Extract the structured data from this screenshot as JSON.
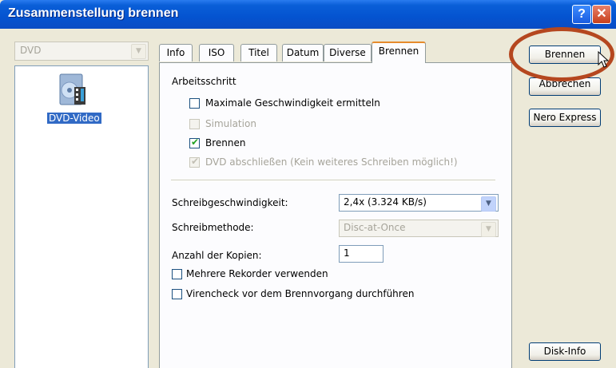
{
  "window": {
    "title": "Zusammenstellung brennen",
    "help_glyph": "?",
    "close_glyph": "✕"
  },
  "left": {
    "disc_type_select": "DVD",
    "items": [
      {
        "label": "DVD-Video",
        "icon": "dvd-video-icon"
      }
    ]
  },
  "tabs": [
    {
      "label": "Info",
      "active": false
    },
    {
      "label": "ISO",
      "active": false
    },
    {
      "label": "Titel",
      "active": false
    },
    {
      "label": "Datum",
      "active": false
    },
    {
      "label": "Diverse",
      "active": false
    },
    {
      "label": "Brennen",
      "active": true
    }
  ],
  "burn": {
    "section_title": "Arbeitsschritt",
    "max_speed": {
      "label": "Maximale Geschwindigkeit ermitteln",
      "checked": false,
      "enabled": true
    },
    "simulation": {
      "label": "Simulation",
      "checked": false,
      "enabled": false
    },
    "burn": {
      "label": "Brennen",
      "checked": true,
      "enabled": true
    },
    "finalize": {
      "label": "DVD abschließen (Kein weiteres Schreiben möglich!)",
      "checked": true,
      "enabled": false
    },
    "write_speed_label": "Schreibgeschwindigkeit:",
    "write_speed_value": "2,4x (3.324 KB/s)",
    "write_method_label": "Schreibmethode:",
    "write_method_value": "Disc-at-Once",
    "copies_label": "Anzahl der Kopien:",
    "copies_value": "1",
    "multi_recorder": {
      "label": "Mehrere Rekorder verwenden",
      "checked": false
    },
    "virus_check": {
      "label": "Virencheck vor dem Brennvorgang durchführen",
      "checked": false
    }
  },
  "buttons": {
    "burn": "Brennen",
    "cancel": "Abbrechen",
    "nero_express": "Nero Express",
    "disk_info": "Disk-Info"
  },
  "colors": {
    "titlebar": "#0453d0",
    "annotation_ring": "#b5471f",
    "active_tab_accent": "#e68b2c",
    "selection": "#316ac5"
  }
}
